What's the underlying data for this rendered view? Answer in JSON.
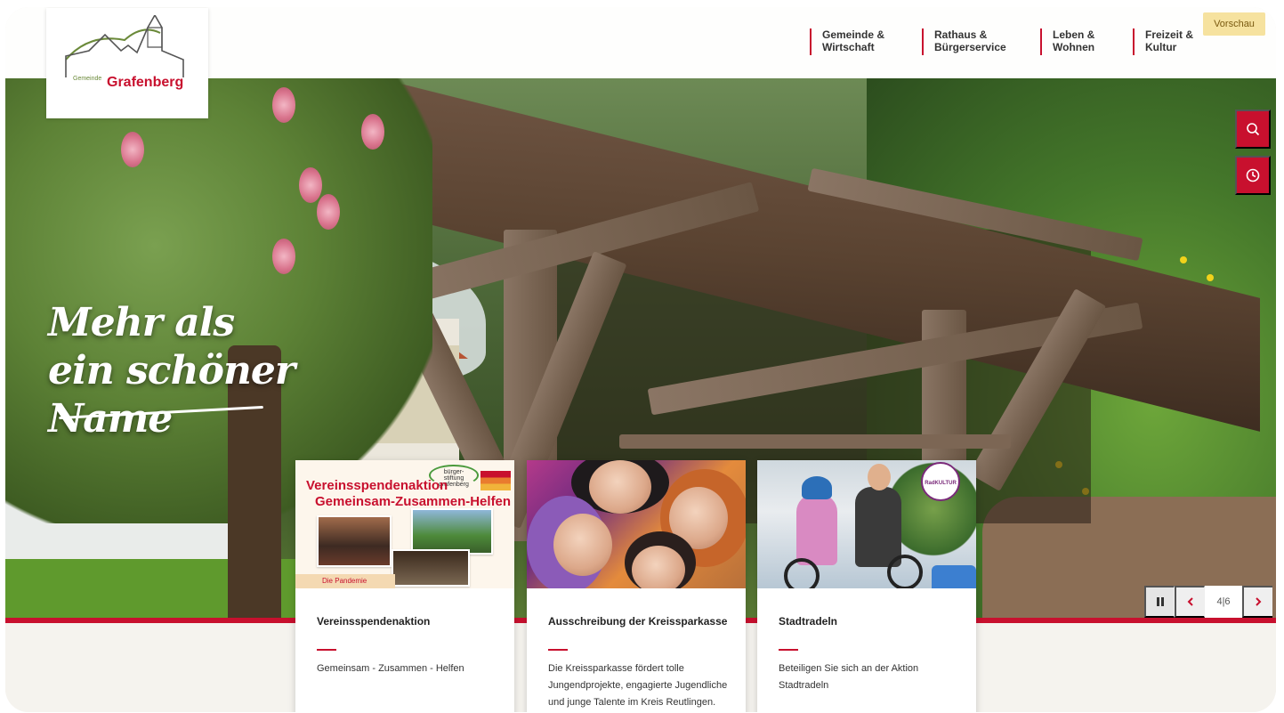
{
  "header": {
    "logo": {
      "small_text": "Gemeinde",
      "name": "Grafenberg"
    },
    "nav": [
      {
        "label": "Gemeinde &\nWirtschaft"
      },
      {
        "label": "Rathaus &\nBürgerservice"
      },
      {
        "label": "Leben &\nWohnen"
      },
      {
        "label": "Freizeit &\nKultur"
      }
    ],
    "preview_badge": "Vorschau"
  },
  "hero": {
    "headline": "Mehr als ein schöner Name"
  },
  "tools": {
    "search_icon": "search-icon",
    "history_icon": "clock-icon",
    "accent_color": "#c8102e"
  },
  "slider": {
    "counter": "4|6",
    "current": 4,
    "total": 6
  },
  "cards": [
    {
      "title": "Vereinsspendenaktion",
      "text": "Gemeinsam - Zusammen - Helfen",
      "image": {
        "headline_1": "Vereinsspendenaktion",
        "headline_2": "Gemeinsam-Zusammen-Helfen",
        "logo_text": "bürger-\nstiftung\ngrafenberg",
        "footer": "Die Pandemie"
      }
    },
    {
      "title": "Ausschreibung der Kreissparkasse",
      "text": "Die Kreissparkasse fördert tolle Jungendprojekte, engagierte Jugendliche und junge Talente im Kreis Reutlingen."
    },
    {
      "title": "Stadtradeln",
      "text": "Beteiligen Sie sich an der Aktion Stadtradeln",
      "image": {
        "badge": "RadKULTUR"
      }
    }
  ]
}
